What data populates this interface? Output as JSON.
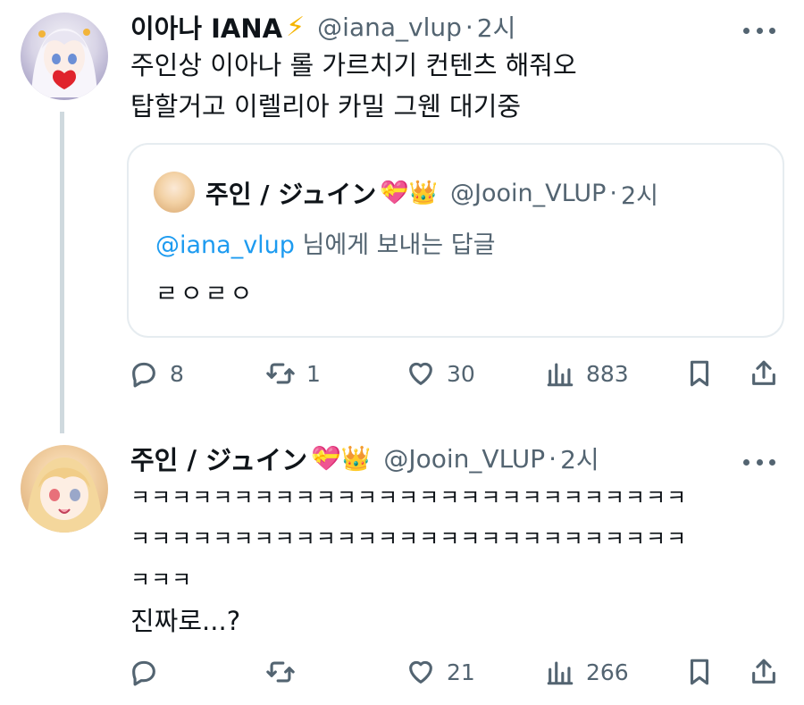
{
  "tweet1": {
    "author_name": "이아나 IANA",
    "verified_emoji": "⚡",
    "handle": "@iana_vlup",
    "dot": "·",
    "time": "2시",
    "lines": [
      "주인상 이아나 롤 가르치기 컨텐츠 해줘오",
      "탑할거고 이렐리아 카밀 그웬 대기중"
    ],
    "quote": {
      "author_name": "주인 / ジュイン",
      "emojis": "💝👑",
      "handle": "@Jooin_VLUP",
      "dot": "·",
      "time": "2시",
      "reply_mention": "@iana_vlup",
      "reply_suffix": " 님에게 보내는 답글",
      "text": "ㄹㅇㄹㅇ"
    },
    "actions": {
      "reply_count": "8",
      "retweet_count": "1",
      "like_count": "30",
      "view_count": "883"
    }
  },
  "tweet2": {
    "author_name": "주인 / ジュイン",
    "emojis": "💝👑",
    "handle": "@Jooin_VLUP",
    "dot": "·",
    "time": "2시",
    "lines": [
      "ㅋㅋㅋㅋㅋㅋㅋㅋㅋㅋㅋㅋㅋㅋㅋㅋㅋㅋㅋㅋㅋㅋㅋㅋㅋㅋㅋ",
      "ㅋㅋㅋㅋㅋㅋㅋㅋㅋㅋㅋㅋㅋㅋㅋㅋㅋㅋㅋㅋㅋㅋㅋㅋㅋㅋㅋ",
      "ㅋㅋㅋ",
      "진짜로...?"
    ],
    "actions": {
      "reply_count": "",
      "retweet_count": "",
      "like_count": "21",
      "view_count": "266"
    }
  },
  "colors": {
    "text": "#0f1419",
    "secondary": "#536471",
    "link": "#1d9bf0",
    "thread_line": "#cfd9de",
    "verified": "#f5b400"
  }
}
